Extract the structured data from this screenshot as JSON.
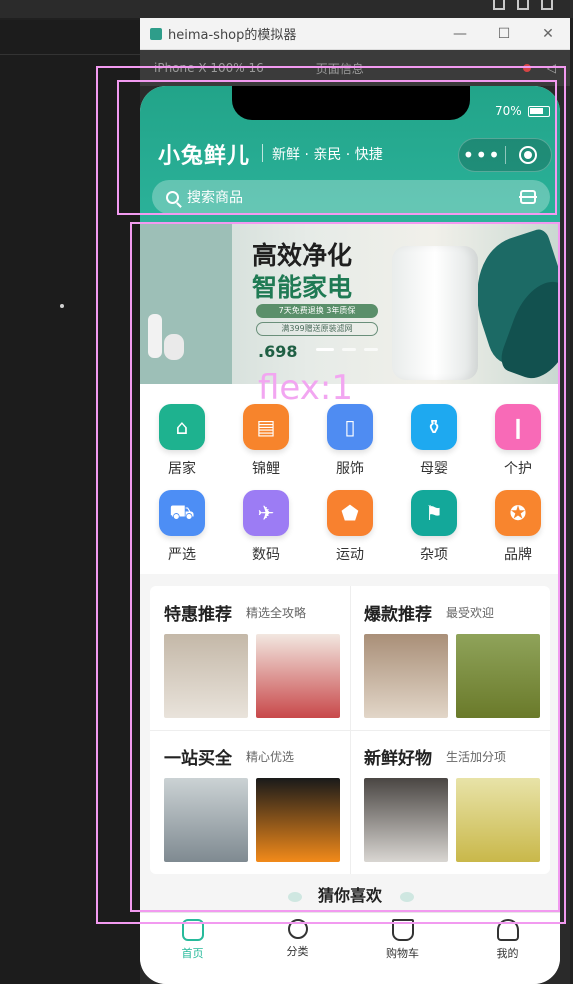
{
  "window": {
    "title": "heima-shop的模拟器",
    "toolbar": {
      "device": "iPhone X 100% 16",
      "page_info": "页面信息"
    }
  },
  "status_bar": {
    "battery": "70%"
  },
  "header": {
    "brand": "小兔鲜儿",
    "slogan": "新鲜 · 亲民 · 快捷",
    "capsule_more": "•••",
    "search_placeholder": "搜索商品"
  },
  "banner": {
    "title": "高效净化",
    "subtitle": "智能家电",
    "tag1": "7天免费退换 3年质保",
    "tag2": "满399赠送原装滤网",
    "price": ".698"
  },
  "categories": [
    {
      "label": "居家",
      "icon": "cloche-icon",
      "color": "#1eb28f"
    },
    {
      "label": "锦鲤",
      "icon": "box-icon",
      "color": "#f7842c"
    },
    {
      "label": "服饰",
      "icon": "phone-icon",
      "color": "#4f8cf2"
    },
    {
      "label": "母婴",
      "icon": "bottle-icon",
      "color": "#1ea9f0"
    },
    {
      "label": "个护",
      "icon": "lipstick-icon",
      "color": "#f86ab7"
    },
    {
      "label": "严选",
      "icon": "car-icon",
      "color": "#4d8ef5"
    },
    {
      "label": "数码",
      "icon": "plane-icon",
      "color": "#9c7cf4"
    },
    {
      "label": "运动",
      "icon": "tag-icon",
      "color": "#f8812f"
    },
    {
      "label": "杂项",
      "icon": "bookmark-icon",
      "color": "#13a89a"
    },
    {
      "label": "品牌",
      "icon": "medal-icon",
      "color": "#f8852e"
    }
  ],
  "panels": [
    {
      "title": "特惠推荐",
      "sub": "精选全攻略"
    },
    {
      "title": "爆款推荐",
      "sub": "最受欢迎"
    },
    {
      "title": "一站买全",
      "sub": "精心优选"
    },
    {
      "title": "新鲜好物",
      "sub": "生活加分项"
    }
  ],
  "guess": "猜你喜欢",
  "tabbar": [
    {
      "label": "首页",
      "icon": "home-icon"
    },
    {
      "label": "分类",
      "icon": "category-icon"
    },
    {
      "label": "购物车",
      "icon": "cart-icon"
    },
    {
      "label": "我的",
      "icon": "user-icon"
    }
  ],
  "overlay": {
    "flex_label": "flex:1"
  }
}
